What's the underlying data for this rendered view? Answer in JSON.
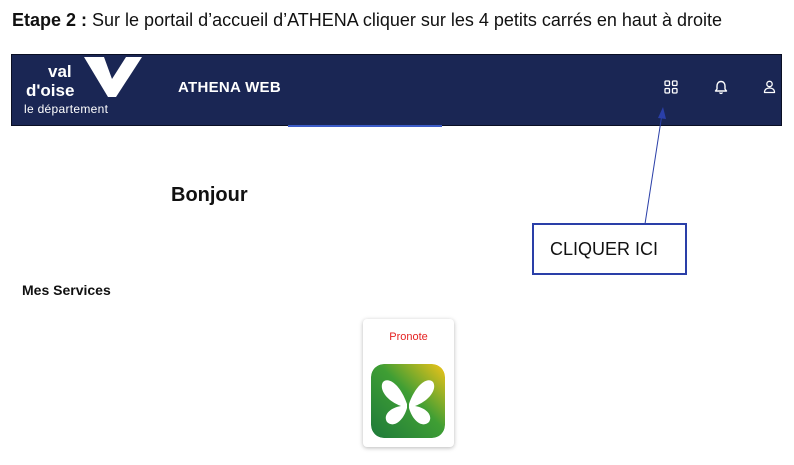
{
  "instruction": {
    "step_label": "Etape 2 :",
    "text": " Sur le portail d’accueil d’ATHENA cliquer sur les 4 petits carrés en haut à droite"
  },
  "header": {
    "logo": {
      "line1": "val",
      "line2": "d'oise",
      "line3": "le département"
    },
    "app_title": "ATHENA WEB",
    "icons": [
      "apps-grid-icon",
      "bell-icon",
      "user-icon"
    ],
    "background_color": "#1a2654"
  },
  "main": {
    "greeting": "Bonjour",
    "services_heading": "Mes Services",
    "services": [
      {
        "label": "Pronote",
        "icon": "pronote-butterfly-icon",
        "label_color": "#e52222"
      }
    ]
  },
  "annotation": {
    "callout_text": "CLIQUER ICI",
    "border_color": "#2a3fa8"
  }
}
